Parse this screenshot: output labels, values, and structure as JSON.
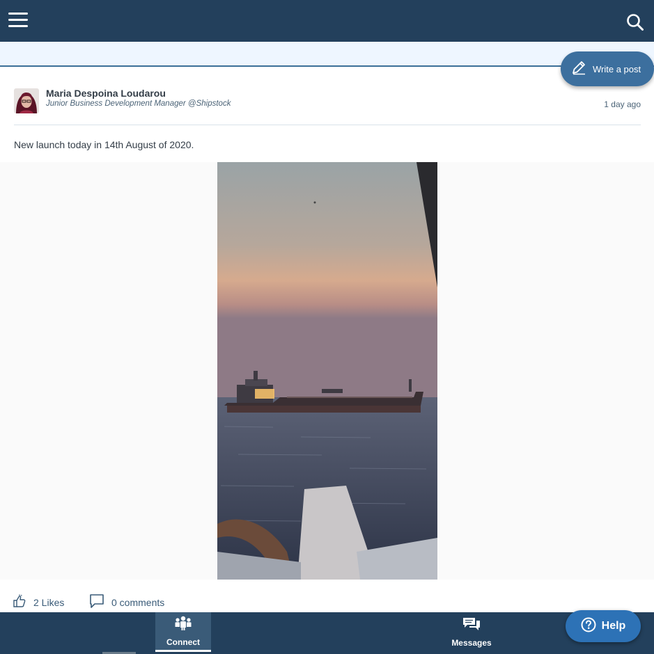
{
  "header": {
    "menu_icon": "hamburger-menu-icon",
    "search_icon": "search-icon",
    "background": "#23405c"
  },
  "compose": {
    "write_post_label": "Write a post",
    "icon": "pencil-icon",
    "color": "#3c6f9e"
  },
  "post": {
    "author_name": "Maria Despoina Loudarou",
    "author_subtitle": "Junior Business Development Manager @Shipstock",
    "time_ago": "1 day ago",
    "text": "New launch today in 14th August of 2020.",
    "image_icon": "ship-photo",
    "likes_label": "2 Likes",
    "comments_label": "0 comments"
  },
  "bottom_nav": {
    "items": [
      {
        "label": "Connect",
        "icon": "people-icon",
        "active": true
      },
      {
        "label": "Messages",
        "icon": "chat-bubbles-icon",
        "active": false
      }
    ],
    "help_label": "Help",
    "help_icon": "question-circle-icon",
    "help_color": "#2d72b6"
  }
}
